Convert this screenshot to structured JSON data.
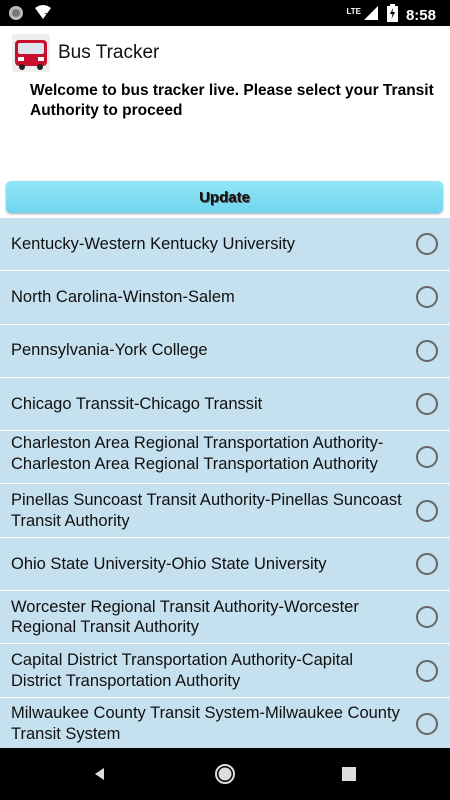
{
  "status_bar": {
    "time": "8:58",
    "network": "LTE",
    "icons": [
      "notification-icon",
      "signal-icon",
      "battery-charging-icon"
    ]
  },
  "app_bar": {
    "title": "Bus Tracker",
    "icon": "bus-icon"
  },
  "welcome_text": "Welcome to bus tracker live. Please select your Transit Authority to proceed",
  "update_button_label": "Update",
  "authorities": [
    {
      "label": "Kentucky-Western Kentucky University",
      "selected": false
    },
    {
      "label": "North Carolina-Winston-Salem",
      "selected": false
    },
    {
      "label": "Pennsylvania-York College",
      "selected": false
    },
    {
      "label": "Chicago Transsit-Chicago Transsit",
      "selected": false
    },
    {
      "label": "Charleston Area Regional Transportation Authority-Charleston Area Regional Transportation Authority",
      "selected": false
    },
    {
      "label": "Pinellas Suncoast Transit Authority-Pinellas Suncoast Transit Authority",
      "selected": false
    },
    {
      "label": "Ohio State University-Ohio State University",
      "selected": false
    },
    {
      "label": "Worcester Regional Transit Authority-Worcester Regional Transit Authority",
      "selected": false
    },
    {
      "label": "Capital District Transportation Authority-Capital District Transportation Authority",
      "selected": false
    },
    {
      "label": "Milwaukee County Transit System-Milwaukee County Transit System",
      "selected": false
    }
  ],
  "colors": {
    "list_background": "#c5e0ee",
    "button_accent": "#7dddf2"
  },
  "nav_bar": {
    "buttons": [
      "back-icon",
      "home-icon",
      "recents-icon"
    ]
  }
}
